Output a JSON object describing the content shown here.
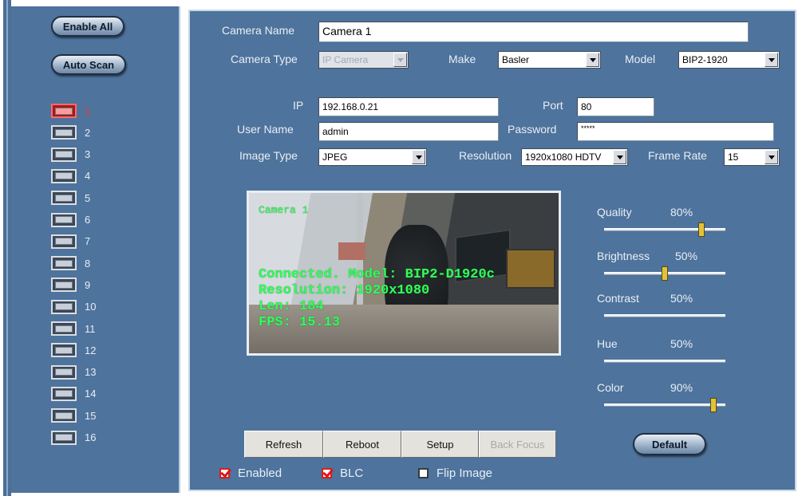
{
  "left": {
    "enable_all": "Enable All",
    "auto_scan": "Auto Scan",
    "cameras": [
      "1",
      "2",
      "3",
      "4",
      "5",
      "6",
      "7",
      "8",
      "9",
      "10",
      "11",
      "12",
      "13",
      "14",
      "15",
      "16"
    ]
  },
  "form": {
    "camera_name_label": "Camera Name",
    "camera_name_value": "Camera 1",
    "camera_type_label": "Camera Type",
    "camera_type_value": "IP Camera",
    "make_label": "Make",
    "make_value": "Basler",
    "model_label": "Model",
    "model_value": "BIP2-1920",
    "ip_label": "IP",
    "ip_value": "192.168.0.21",
    "port_label": "Port",
    "port_value": "80",
    "user_label": "User Name",
    "user_value": "admin",
    "password_label": "Password",
    "password_value": "*****",
    "image_type_label": "Image Type",
    "image_type_value": "JPEG",
    "resolution_label": "Resolution",
    "resolution_value": "1920x1080 HDTV",
    "frame_rate_label": "Frame Rate",
    "frame_rate_value": "15"
  },
  "preview": {
    "camera_tag": "Camera 1",
    "line1": "Connected. Model: BIP2-D1920c",
    "line2": "Resolution: 1920x1080",
    "line3": "Len: 184",
    "line4": "FPS: 15.13"
  },
  "sliders": [
    {
      "label": "Quality",
      "value": "80%",
      "level": 0.8
    },
    {
      "label": "Brightness",
      "value": "50%",
      "level": 0.5
    },
    {
      "label": "Contrast",
      "value": "50%",
      "level": null
    },
    {
      "label": "Hue",
      "value": "50%",
      "level": null
    },
    {
      "label": "Color",
      "value": "90%",
      "level": 0.9
    }
  ],
  "buttons": {
    "refresh": "Refresh",
    "reboot": "Reboot",
    "setup": "Setup",
    "back_focus": "Back Focus",
    "default": "Default"
  },
  "checks": {
    "enabled": "Enabled",
    "blc": "BLC",
    "flip": "Flip Image"
  }
}
